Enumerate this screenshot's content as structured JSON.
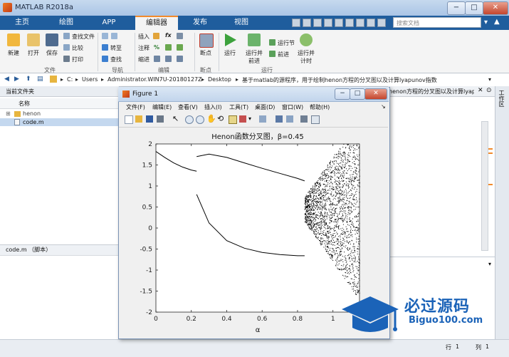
{
  "app": {
    "title": "MATLAB R2018a",
    "window_controls": [
      "−",
      "□",
      "✕"
    ]
  },
  "tabs": [
    "主页",
    "绘图",
    "APP",
    "编辑器",
    "发布",
    "视图"
  ],
  "active_tab": "编辑器",
  "search": {
    "placeholder": "搜索文档"
  },
  "ribbon": {
    "file": {
      "new": "新建",
      "open": "打开",
      "save": "保存",
      "find_files": "查找文件",
      "compare": "比较",
      "print": "打印",
      "group": "文件"
    },
    "navigate": {
      "goto": "转至",
      "find": "查找",
      "group": "导航"
    },
    "edit": {
      "insert": "插入",
      "fx": "fx",
      "comment": "注释",
      "indent": "缩进",
      "percent": "%",
      "group": "编辑"
    },
    "breakpoints": {
      "label": "断点",
      "group": "断点"
    },
    "run": {
      "run": "运行",
      "run_advance_1": "运行并",
      "run_advance_2": "前进",
      "run_section": "运行节",
      "advance": "前进",
      "run_time_1": "运行并",
      "run_time_2": "计时",
      "group": "运行"
    }
  },
  "address": {
    "crumbs": [
      "C:",
      "Users",
      "Administrator.WIN7U-20180127Z",
      "Desktop",
      "基于matlab的源程序，用于绘制henon方程的分叉图以及计算lyapunov指数"
    ]
  },
  "left_pane": {
    "title": "当前文件夹",
    "column": "名称",
    "items": [
      {
        "name": "henon",
        "type": "folder"
      },
      {
        "name": "code.m",
        "type": "file"
      }
    ],
    "details": "code.m （脚本）"
  },
  "right_pane": {
    "tab_label": "henon方程的分叉图以及计算lyapunov指数"
  },
  "right_sidebar": {
    "label": "工作区"
  },
  "status": {
    "row_label": "行",
    "row": "1",
    "col_label": "列",
    "col": "1"
  },
  "figure": {
    "title": "Figure 1",
    "menus": [
      "文件(F)",
      "编辑(E)",
      "查看(V)",
      "插入(I)",
      "工具(T)",
      "桌面(D)",
      "窗口(W)",
      "帮助(H)"
    ]
  },
  "chart_data": {
    "type": "scatter",
    "title": "Henon函数分叉图，β=0.45",
    "xlabel": "α",
    "ylabel": "",
    "xlim": [
      0,
      1.15
    ],
    "ylim": [
      -2,
      2
    ],
    "xticks": [
      0,
      0.2,
      0.4,
      0.6,
      0.8,
      1
    ],
    "yticks": [
      2,
      1.5,
      1,
      0.5,
      0,
      -0.5,
      -1,
      -1.5,
      -2
    ],
    "grid": false,
    "series": [
      {
        "x": [
          0,
          0.05,
          0.1,
          0.15,
          0.2,
          0.23
        ],
        "values": [
          1.82,
          1.68,
          1.55,
          1.45,
          1.38,
          1.35
        ]
      },
      {
        "x": [
          0.23,
          0.3,
          0.4,
          0.5,
          0.6,
          0.7,
          0.8,
          0.84
        ],
        "values": [
          1.7,
          1.76,
          1.68,
          1.55,
          1.42,
          1.3,
          1.18,
          1.12
        ]
      },
      {
        "x": [
          0.23,
          0.3,
          0.4,
          0.5,
          0.6,
          0.7,
          0.8,
          0.84
        ],
        "values": [
          0.8,
          0.12,
          -0.3,
          -0.48,
          -0.58,
          -0.63,
          -0.66,
          -0.66
        ]
      }
    ]
  },
  "watermark": {
    "text": "必过源码",
    "url": "Biguo100.com"
  },
  "colors": {
    "accent": "#1f5d9d",
    "tab_highlight": "#f28b2c",
    "watermark": "#1b63b8"
  }
}
